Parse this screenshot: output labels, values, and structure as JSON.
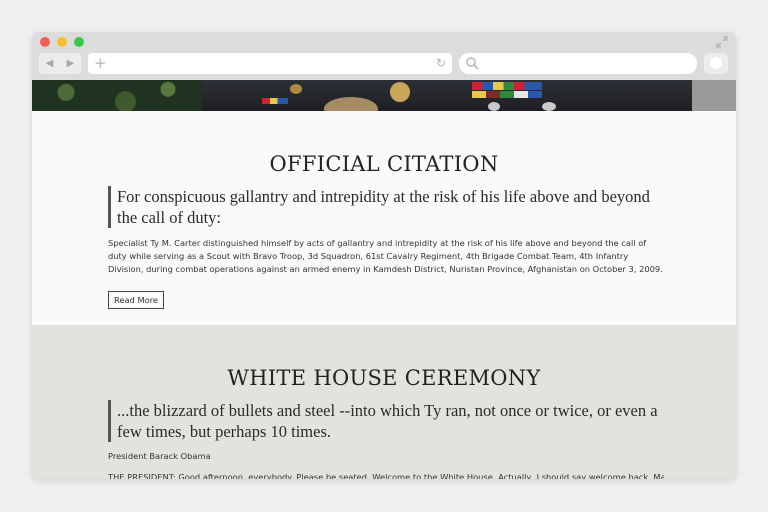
{
  "browser": {
    "back_arrow": "◀",
    "forward_arrow": "▶",
    "new_tab_glyph": "+",
    "reload_glyph": "↻",
    "icons": [
      "close-dot",
      "minimize-dot",
      "maximize-dot",
      "back-arrow-icon",
      "forward-arrow-icon",
      "plus-icon",
      "reload-icon",
      "search-icon",
      "extension-icon",
      "expand-icon"
    ],
    "colors": {
      "close": "#f25f58",
      "minimize": "#f9be2f",
      "maximize": "#3ac64a",
      "chrome": "#dcdcdc"
    }
  },
  "citation": {
    "heading": "OFFICIAL CITATION",
    "quote": "For conspicuous gallantry and intrepidity at the risk of his life above and beyond the call of duty:",
    "body": "Specialist Ty M. Carter distinguished himself by acts of gallantry and intrepidity at the risk of his life above and beyond the call of duty while serving as a Scout with Bravo Troop, 3d Squadron, 61st Cavalry Regiment, 4th Brigade Combat Team, 4th Infantry Division, during combat operations against an armed enemy in Kamdesh District, Nuristan Province, Afghanistan on October 3, 2009.",
    "read_more_label": "Read More"
  },
  "ceremony": {
    "heading": "WHITE HOUSE CEREMONY",
    "quote": "...the blizzard of bullets and steel --into which Ty ran, not once or twice, or even a few times, but perhaps 10 times.",
    "attribution": "President Barack Obama",
    "transcript_start": "THE PRESIDENT: Good afternoon, everybody. Please be seated. Welcome to the White House. Actually, I should say welcome back. Many",
    "background_color": "#e4e2dd"
  }
}
